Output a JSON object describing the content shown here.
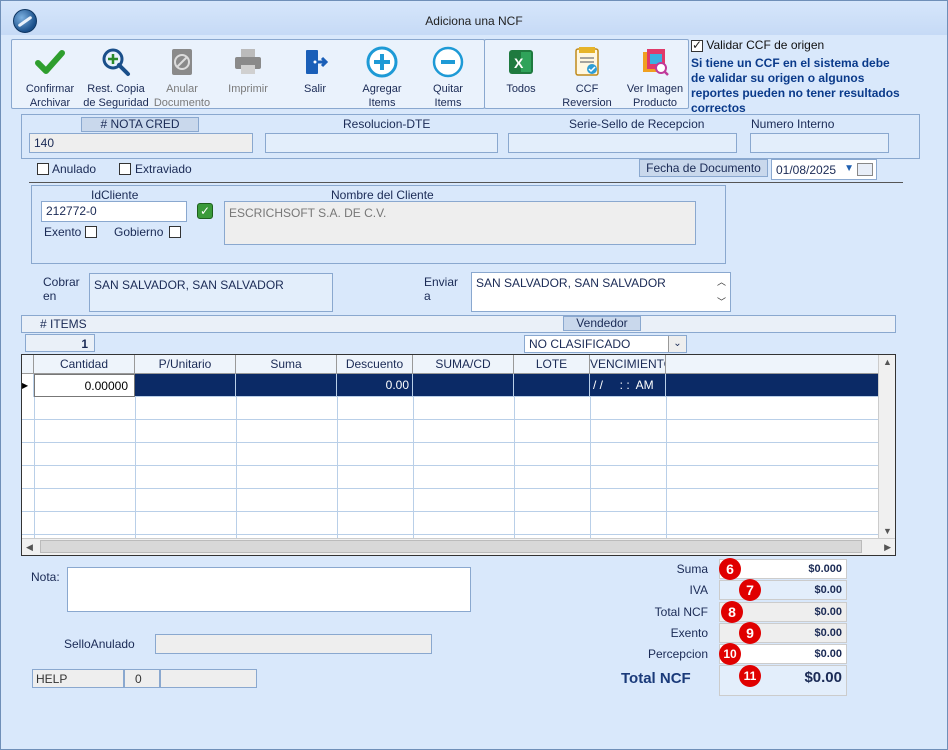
{
  "window": {
    "title": "Adiciona una NCF"
  },
  "toolbar": {
    "confirmar": "Confirmar\nArchivar",
    "rest_copia": "Rest. Copia\nde Seguridad",
    "anular": "Anular\nDocumento",
    "imprimir": "Imprimir",
    "salir": "Salir",
    "agregar": "Agregar\nItems",
    "quitar": "Quitar\nItems",
    "todos": "Todos",
    "ccf_reversion": "CCF\nReversion",
    "ver_imagen": "Ver Imagen\nProducto",
    "ccf_icon_text": "CCF"
  },
  "validar": {
    "label": "Validar CCF de origen",
    "checked": true,
    "note": "Si tiene un CCF en el sistema debe de validar su origen o algunos reportes pueden no tener resultados correctos"
  },
  "header": {
    "nota_cred_label": "# NOTA CRED",
    "nota_cred_value": "140",
    "resolucion_label": "Resolucion-DTE",
    "resolucion_value": "",
    "serie_label": "Serie-Sello de Recepcion",
    "serie_value": "",
    "numero_label": "Numero Interno",
    "numero_value": ""
  },
  "flags": {
    "anulado": "Anulado",
    "extraviado": "Extraviado"
  },
  "fecha": {
    "label": "Fecha de Documento",
    "value": "01/08/2025"
  },
  "cliente": {
    "id_label": "IdCliente",
    "id_value": "212772-0",
    "nombre_label": "Nombre del Cliente",
    "nombre_value": "ESCRICHSOFT S.A. DE C.V.",
    "exento": "Exento",
    "gobierno": "Gobierno"
  },
  "cobrar": {
    "label": "Cobrar\nen",
    "value": "SAN SALVADOR, SAN SALVADOR"
  },
  "enviar": {
    "label": "Enviar\na",
    "value": "SAN SALVADOR, SAN SALVADOR"
  },
  "items": {
    "count_label": "# ITEMS",
    "count_value": "1",
    "vendedor_label": "Vendedor",
    "vendedor_value": "NO CLASIFICADO"
  },
  "grid": {
    "columns": [
      "Cantidad",
      "P/Unitario",
      "Suma",
      "Descuento",
      "SUMA/CD",
      "LOTE",
      "VENCIMIENTO"
    ],
    "row": [
      "0.00000",
      "",
      "",
      "0.00",
      "",
      "",
      "/ /     : :  AM"
    ]
  },
  "bottom": {
    "nota_label": "Nota:",
    "nota_value": "",
    "sello_label": "SelloAnulado",
    "sello_value": "",
    "help": "HELP",
    "help_num": "0"
  },
  "totals": {
    "suma_label": "Suma",
    "suma_value": "$0.000",
    "iva_label": "IVA",
    "iva_value": "$0.00",
    "total_ncf_label": "Total NCF",
    "total_ncf_value": "$0.00",
    "exento_label": "Exento",
    "exento_value": "$0.00",
    "percepcion_label": "Percepcion",
    "percepcion_value": "$0.00",
    "grand_label": "Total NCF",
    "grand_value": "$0.00",
    "badges": [
      "6",
      "7",
      "8",
      "9",
      "10",
      "11"
    ]
  }
}
